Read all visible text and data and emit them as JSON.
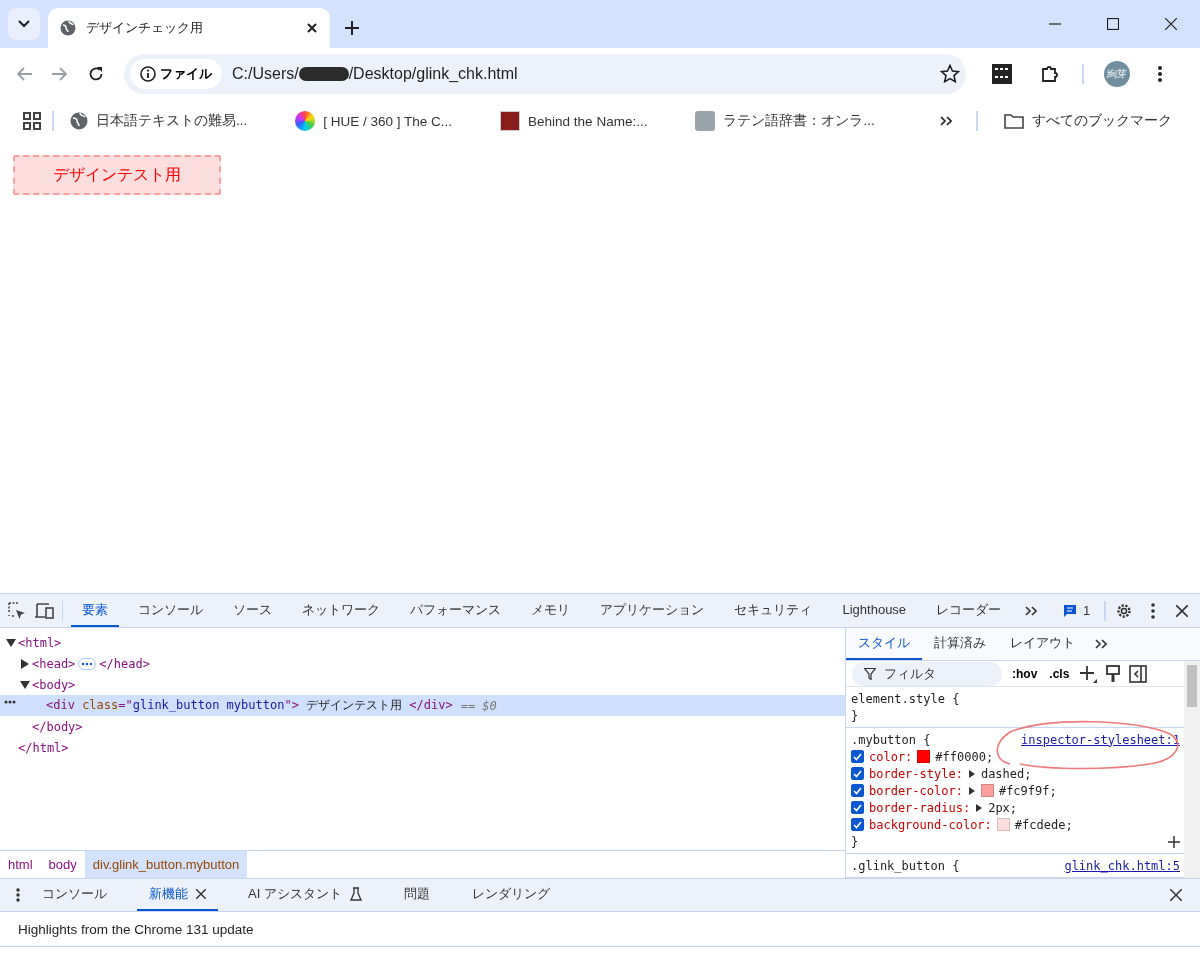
{
  "browser": {
    "tab_title": "デザインチェック用",
    "security_chip": "ファイル",
    "url_prefix": "C:/Users/",
    "url_redacted": true,
    "url_suffix": "/Desktop/glink_chk.html",
    "avatar": "絢芽"
  },
  "bookmarks": [
    {
      "title": "日本語テキストの難易...",
      "kind": "globe"
    },
    {
      "title": "[ HUE / 360 ] The C...",
      "kind": "wheel"
    },
    {
      "title": "Behind the Name:...",
      "kind": "logo"
    },
    {
      "title": "ラテン語辞書：オンラ...",
      "kind": "photo"
    }
  ],
  "all_bookmarks": "すべてのブックマーク",
  "page": {
    "button_label": "デザインテスト用"
  },
  "devtools": {
    "tabs": [
      {
        "label": "要素",
        "selected": true
      },
      {
        "label": "コンソール",
        "selected": false
      },
      {
        "label": "ソース",
        "selected": false
      },
      {
        "label": "ネットワーク",
        "selected": false
      },
      {
        "label": "パフォーマンス",
        "selected": false
      },
      {
        "label": "メモリ",
        "selected": false
      },
      {
        "label": "アプリケーション",
        "selected": false
      },
      {
        "label": "セキュリティ",
        "selected": false
      },
      {
        "label": "Lighthouse",
        "selected": false
      },
      {
        "label": "レコーダー",
        "selected": false
      }
    ],
    "issues_count": "1",
    "dom": [
      {
        "open": [
          {
            "kind": "tag",
            "text": "<html>"
          }
        ],
        "close": "</html>",
        "expanded": true,
        "selected": false,
        "children": [
          {
            "open": [
              {
                "kind": "tag",
                "text": "<head>"
              }
            ],
            "close": "</head>",
            "expanded": false,
            "selected": false
          },
          {
            "open": [
              {
                "kind": "tag",
                "text": "<body>"
              }
            ],
            "close": "</body>",
            "expanded": true,
            "selected": false,
            "children": [
              {
                "open": [
                  {
                    "kind": "tag",
                    "text": "<div "
                  },
                  {
                    "kind": "attr",
                    "text": "class"
                  },
                  {
                    "kind": "tag",
                    "text": "=\""
                  },
                  {
                    "kind": "value",
                    "text": "glink_button mybutton"
                  },
                  {
                    "kind": "tag",
                    "text": "\">"
                  },
                  {
                    "kind": "text",
                    "text": " デザインテスト用 "
                  },
                  {
                    "kind": "tag",
                    "text": "</div>"
                  }
                ],
                "ref": "== $0",
                "selected": true
              }
            ]
          }
        ]
      }
    ],
    "breadcrumbs": [
      {
        "label": "html",
        "selected": false
      },
      {
        "label": "body",
        "selected": false
      },
      {
        "label": "div.glink_button.mybutton",
        "selected": true
      }
    ],
    "style_tabs": [
      {
        "label": "スタイル",
        "selected": true
      },
      {
        "label": "計算済み",
        "selected": false
      },
      {
        "label": "レイアウト",
        "selected": false
      }
    ],
    "filter_placeholder": "フィルタ",
    "hov": ":hov",
    "cls": ".cls",
    "rules": [
      {
        "header": "element.style {",
        "close": "}",
        "annotated": false
      },
      {
        "header": ".mybutton {",
        "source": "inspector-stylesheet:1",
        "annotated": true,
        "close": "}",
        "declarations": [
          {
            "property": "color:",
            "value": "#ff0000;",
            "color": "#ff0000",
            "expandable": false,
            "checked": true
          },
          {
            "property": "border-style:",
            "value": "dashed;",
            "expandable": true,
            "checked": true
          },
          {
            "property": "border-color:",
            "value": "#fc9f9f;",
            "color": "#fc9f9f",
            "expandable": true,
            "checked": true
          },
          {
            "property": "border-radius:",
            "value": "2px;",
            "expandable": true,
            "checked": true
          },
          {
            "property": "background-color:",
            "value": "#fcdede;",
            "color": "#fcdede",
            "expandable": false,
            "checked": true
          }
        ]
      },
      {
        "header": ".glink_button {",
        "source": "glink_chk.html:5",
        "annotated": false
      }
    ],
    "drawer_tabs": [
      {
        "label": "コンソール",
        "selected": false,
        "kind": "plain"
      },
      {
        "label": "新機能",
        "selected": true,
        "kind": "closable"
      },
      {
        "label": "AI アシスタント",
        "selected": false,
        "kind": "experimental"
      },
      {
        "label": "問題",
        "selected": false,
        "kind": "plain"
      },
      {
        "label": "レンダリング",
        "selected": false,
        "kind": "plain"
      }
    ],
    "drawer_text": "Highlights from the Chrome 131 update"
  }
}
